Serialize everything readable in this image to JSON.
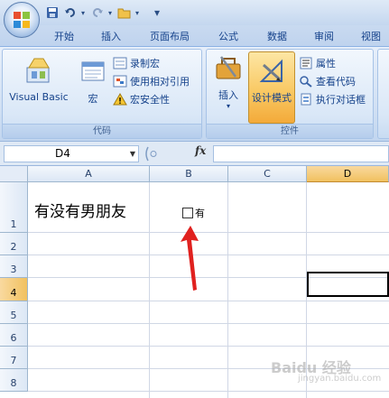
{
  "tabs": [
    "开始",
    "插入",
    "页面布局",
    "公式",
    "数据",
    "审阅",
    "视图"
  ],
  "groups": {
    "code": {
      "label": "代码",
      "visual_basic": "Visual Basic",
      "macro": "宏",
      "record_macro": "录制宏",
      "relative_ref": "使用相对引用",
      "macro_security": "宏安全性"
    },
    "controls": {
      "label": "控件",
      "insert": "插入",
      "design_mode": "设计模式",
      "properties": "属性",
      "view_code": "查看代码",
      "run_dialog": "执行对话框"
    }
  },
  "formula_bar": {
    "name_box": "D4",
    "fx": "fx",
    "value": ""
  },
  "grid": {
    "columns": [
      "A",
      "B",
      "C",
      "D"
    ],
    "rows": [
      "1",
      "2",
      "3",
      "4",
      "5",
      "6",
      "7",
      "8"
    ],
    "selected_column": "D",
    "selected_row": "4",
    "a1_text": "有没有男朋友",
    "checkbox_label": "有"
  },
  "watermark": {
    "main": "Baidu 经验",
    "sub": "jingyan.baidu.com"
  }
}
